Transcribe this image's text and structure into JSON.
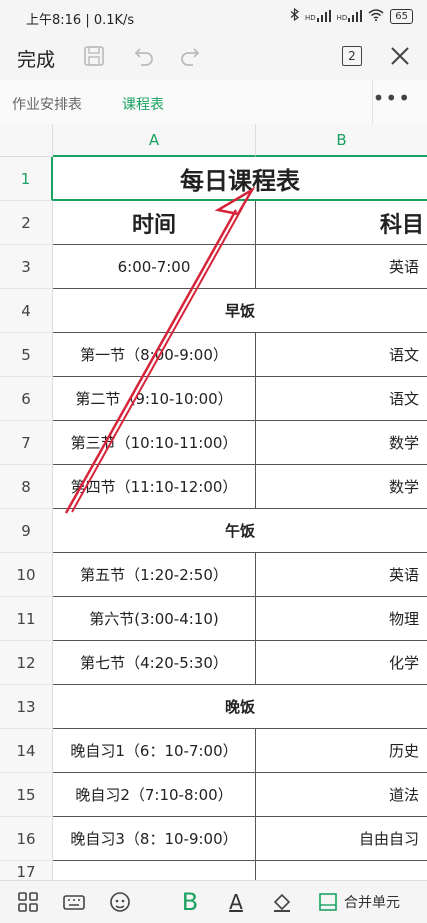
{
  "status_bar": {
    "time": "上午8:16 | 0.1K/s",
    "signal1": "HD",
    "signal2": "HD",
    "battery": "65"
  },
  "toolbar": {
    "done_label": "完成",
    "sheet_count": "2",
    "save_icon": "save-icon",
    "undo_icon": "undo-icon",
    "redo_icon": "redo-icon",
    "close_icon": "close-icon"
  },
  "tabs": {
    "sheet1": "作业安排表",
    "sheet2": "课程表",
    "more": "•••"
  },
  "columns": [
    "A",
    "B"
  ],
  "rows": [
    {
      "num": "1",
      "type": "merged",
      "value": "每日课程表"
    },
    {
      "num": "2",
      "type": "header",
      "a": "时间",
      "b": "科目"
    },
    {
      "num": "3",
      "type": "data",
      "a": "6:00-7:00",
      "b": "英语"
    },
    {
      "num": "4",
      "type": "merged",
      "value": "早饭"
    },
    {
      "num": "5",
      "type": "data",
      "a": "第一节（8:00-9:00）",
      "b": "语文"
    },
    {
      "num": "6",
      "type": "data",
      "a": "第二节（9:10-10:00）",
      "b": "语文"
    },
    {
      "num": "7",
      "type": "data",
      "a": "第三节（10:10-11:00）",
      "b": "数学"
    },
    {
      "num": "8",
      "type": "data",
      "a": "第四节（11:10-12:00）",
      "b": "数学"
    },
    {
      "num": "9",
      "type": "merged",
      "value": "午饭"
    },
    {
      "num": "10",
      "type": "data",
      "a": "第五节（1:20-2:50）",
      "b": "英语"
    },
    {
      "num": "11",
      "type": "data",
      "a": "第六节(3:00-4:10)",
      "b": "物理"
    },
    {
      "num": "12",
      "type": "data",
      "a": "第七节（4:20-5:30）",
      "b": "化学"
    },
    {
      "num": "13",
      "type": "merged",
      "value": "晚饭"
    },
    {
      "num": "14",
      "type": "data",
      "a": "晚自习1（6：10-7:00）",
      "b": "历史"
    },
    {
      "num": "15",
      "type": "data",
      "a": "晚自习2（7:10-8:00）",
      "b": "道法"
    },
    {
      "num": "16",
      "type": "data",
      "a": "晚自习3（8：10-9:00）",
      "b": "自由自习"
    },
    {
      "num": "17",
      "type": "empty"
    }
  ],
  "bottom_bar": {
    "merge_label": "合并单元",
    "bold_label": "B",
    "font_color_label": "A"
  },
  "colors": {
    "accent": "#1aa260",
    "annotation_arrow": "#d6243a"
  }
}
